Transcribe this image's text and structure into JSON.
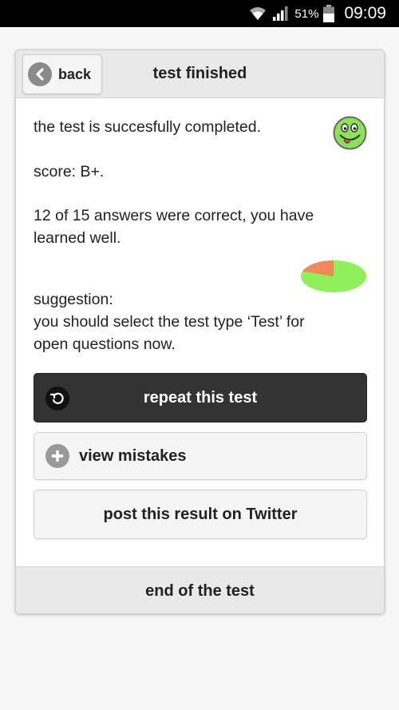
{
  "status_bar": {
    "battery_percent": "51%",
    "time": "09:09",
    "icons": [
      "wifi-icon",
      "signal-icon",
      "battery-icon"
    ]
  },
  "header": {
    "back_label": "back",
    "title": "test finished"
  },
  "result": {
    "completed_text": "the test is succesfully completed.",
    "score_text": "score: B+.",
    "answers_text_line1": "12 of 15 answers were correct, you have",
    "answers_text_line2": "learned well.",
    "suggestion_label": "suggestion:",
    "suggestion_line1": "you should select the test type ‘Test’ for",
    "suggestion_line2": "open questions now.",
    "correct": 12,
    "total": 15
  },
  "buttons": {
    "repeat_label": "repeat this test",
    "mistakes_label": "view mistakes",
    "twitter_label": "post this result on Twitter"
  },
  "footer": {
    "end_label": "end of the test"
  },
  "colors": {
    "correct": "#8ff05c",
    "wrong": "#f08a5a",
    "smiley": "#8ee05a",
    "dark_button": "#333333"
  }
}
